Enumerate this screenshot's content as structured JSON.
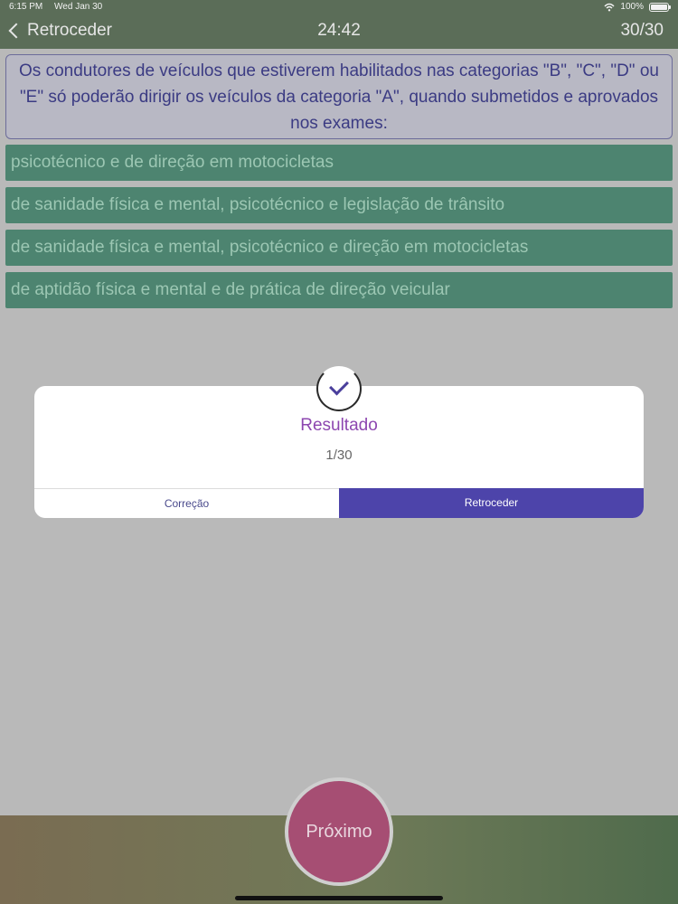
{
  "status_bar": {
    "time": "6:15 PM",
    "date": "Wed Jan 30",
    "battery": "100%"
  },
  "nav": {
    "back_label": "Retroceder",
    "timer": "24:42",
    "counter": "30/30"
  },
  "question": {
    "text": "Os condutores de veículos que estiverem habilitados nas categorias \"B\", \"C\", \"D\" ou \"E\" só poderão dirigir os veículos da categoria \"A\", quando submetidos e aprovados nos exames:"
  },
  "answers": [
    "psicotécnico e de direção em motocicletas",
    "de sanidade física e mental, psicotécnico e legislação de trânsito",
    "de sanidade física e mental, psicotécnico e direção em motocicletas",
    "de aptidão física e mental e de prática de direção veicular"
  ],
  "modal": {
    "title": "Resultado",
    "score": "1/30",
    "left_button": "Correção",
    "right_button": "Retroceder"
  },
  "footer": {
    "next_label": "Próximo"
  },
  "colors": {
    "nav_bg": "#5b6d58",
    "answer_bg": "#4d8470",
    "modal_accent": "#4d44aa",
    "title_purple": "#8d47b0",
    "next_button": "#a64e73"
  },
  "icons": {
    "back": "chevron-left-icon",
    "result": "check-circle-icon",
    "wifi": "wifi-icon",
    "battery": "battery-icon"
  }
}
